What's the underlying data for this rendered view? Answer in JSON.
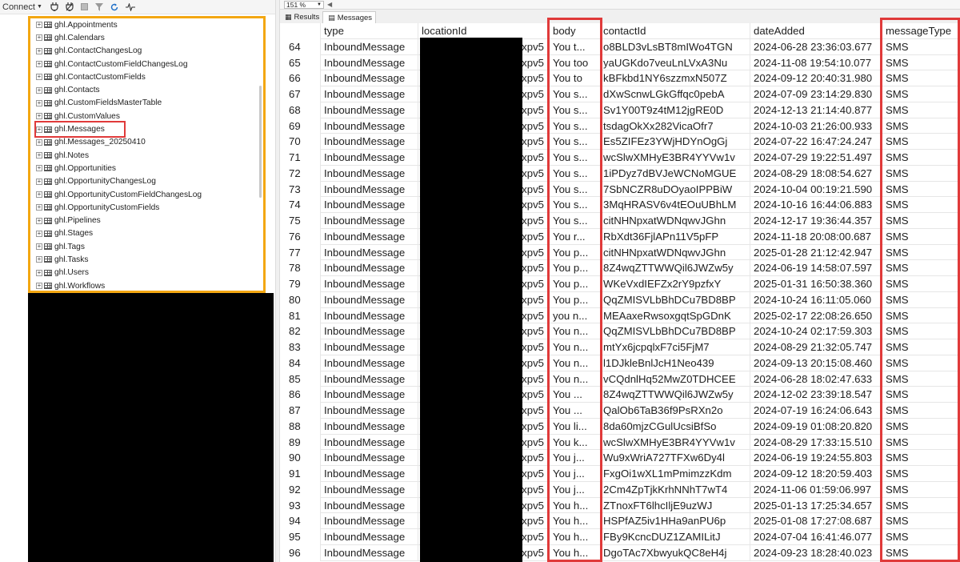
{
  "toolbar": {
    "connect_label": "Connect",
    "icons": [
      "connect-plug-icon",
      "disconnect-icon",
      "stop-icon",
      "filter-icon",
      "refresh-icon",
      "activity-monitor-icon"
    ]
  },
  "tree": {
    "items": [
      {
        "label": "ghl.Appointments"
      },
      {
        "label": "ghl.Calendars"
      },
      {
        "label": "ghl.ContactChangesLog"
      },
      {
        "label": "ghl.ContactCustomFieldChangesLog"
      },
      {
        "label": "ghl.ContactCustomFields"
      },
      {
        "label": "ghl.Contacts"
      },
      {
        "label": "ghl.CustomFieldsMasterTable"
      },
      {
        "label": "ghl.CustomValues"
      },
      {
        "label": "ghl.Messages",
        "selected": true
      },
      {
        "label": "ghl.Messages_20250410"
      },
      {
        "label": "ghl.Notes"
      },
      {
        "label": "ghl.Opportunities"
      },
      {
        "label": "ghl.OpportunityChangesLog"
      },
      {
        "label": "ghl.OpportunityCustomFieldChangesLog"
      },
      {
        "label": "ghl.OpportunityCustomFields"
      },
      {
        "label": "ghl.Pipelines"
      },
      {
        "label": "ghl.Stages"
      },
      {
        "label": "ghl.Tags"
      },
      {
        "label": "ghl.Tasks"
      },
      {
        "label": "ghl.Users"
      },
      {
        "label": "ghl.Workflows"
      }
    ]
  },
  "results": {
    "zoom": "151 %",
    "tabs": [
      {
        "label": "Results",
        "active": false
      },
      {
        "label": "Messages",
        "active": true
      }
    ],
    "columns": [
      "",
      "type",
      "locationId",
      "body",
      "contactId",
      "dateAdded",
      "messageType"
    ],
    "location_suffix": "xpv5",
    "rows": [
      {
        "n": "64",
        "type": "InboundMessage",
        "body": "You t...",
        "contactId": "o8BLD3vLsBT8mIWo4TGN",
        "dateAdded": "2024-06-28 23:36:03.677",
        "messageType": "SMS"
      },
      {
        "n": "65",
        "type": "InboundMessage",
        "body": "You too",
        "contactId": "yaUGKdo7veuLnLVxA3Nu",
        "dateAdded": "2024-11-08 19:54:10.077",
        "messageType": "SMS"
      },
      {
        "n": "66",
        "type": "InboundMessage",
        "body": "You to",
        "contactId": "kBFkbd1NY6szzmxN507Z",
        "dateAdded": "2024-09-12 20:40:31.980",
        "messageType": "SMS"
      },
      {
        "n": "67",
        "type": "InboundMessage",
        "body": "You s...",
        "contactId": "dXwScnwLGkGffqc0pebA",
        "dateAdded": "2024-07-09 23:14:29.830",
        "messageType": "SMS"
      },
      {
        "n": "68",
        "type": "InboundMessage",
        "body": "You s...",
        "contactId": "Sv1Y00T9z4tM12jgRE0D",
        "dateAdded": "2024-12-13 21:14:40.877",
        "messageType": "SMS"
      },
      {
        "n": "69",
        "type": "InboundMessage",
        "body": "You s...",
        "contactId": "tsdagOkXx282VicaOfr7",
        "dateAdded": "2024-10-03 21:26:00.933",
        "messageType": "SMS"
      },
      {
        "n": "70",
        "type": "InboundMessage",
        "body": "You s...",
        "contactId": "Es5ZIFEz3YWjHDYnOgGj",
        "dateAdded": "2024-07-22 16:47:24.247",
        "messageType": "SMS"
      },
      {
        "n": "71",
        "type": "InboundMessage",
        "body": "You s...",
        "contactId": "wcSlwXMHyE3BR4YYVw1v",
        "dateAdded": "2024-07-29 19:22:51.497",
        "messageType": "SMS"
      },
      {
        "n": "72",
        "type": "InboundMessage",
        "body": "You s...",
        "contactId": "1iPDyz7dBVJeWCNoMGUE",
        "dateAdded": "2024-08-29 18:08:54.627",
        "messageType": "SMS"
      },
      {
        "n": "73",
        "type": "InboundMessage",
        "body": "You s...",
        "contactId": "7SbNCZR8uDOyaoIPPBiW",
        "dateAdded": "2024-10-04 00:19:21.590",
        "messageType": "SMS"
      },
      {
        "n": "74",
        "type": "InboundMessage",
        "body": "You s...",
        "contactId": "3MqHRASV6v4tEOuUBhLM",
        "dateAdded": "2024-10-16 16:44:06.883",
        "messageType": "SMS"
      },
      {
        "n": "75",
        "type": "InboundMessage",
        "body": "You s...",
        "contactId": "citNHNpxatWDNqwvJGhn",
        "dateAdded": "2024-12-17 19:36:44.357",
        "messageType": "SMS"
      },
      {
        "n": "76",
        "type": "InboundMessage",
        "body": "You r...",
        "contactId": "RbXdt36FjlAPn11V5pFP",
        "dateAdded": "2024-11-18 20:08:00.687",
        "messageType": "SMS"
      },
      {
        "n": "77",
        "type": "InboundMessage",
        "body": "You p...",
        "contactId": "citNHNpxatWDNqwvJGhn",
        "dateAdded": "2025-01-28 21:12:42.947",
        "messageType": "SMS"
      },
      {
        "n": "78",
        "type": "InboundMessage",
        "body": "You p...",
        "contactId": "8Z4wqZTTWWQil6JWZw5y",
        "dateAdded": "2024-06-19 14:58:07.597",
        "messageType": "SMS"
      },
      {
        "n": "79",
        "type": "InboundMessage",
        "body": "You p...",
        "contactId": "WKeVxdIEFZx2rY9pzfxY",
        "dateAdded": "2025-01-31 16:50:38.360",
        "messageType": "SMS"
      },
      {
        "n": "80",
        "type": "InboundMessage",
        "body": "You p...",
        "contactId": "QqZMISVLbBhDCu7BD8BP",
        "dateAdded": "2024-10-24 16:11:05.060",
        "messageType": "SMS"
      },
      {
        "n": "81",
        "type": "InboundMessage",
        "body": "you n...",
        "contactId": "MEAaxeRwsoxgqtSpGDnK",
        "dateAdded": "2025-02-17 22:08:26.650",
        "messageType": "SMS"
      },
      {
        "n": "82",
        "type": "InboundMessage",
        "body": "You n...",
        "contactId": "QqZMISVLbBhDCu7BD8BP",
        "dateAdded": "2024-10-24 02:17:59.303",
        "messageType": "SMS"
      },
      {
        "n": "83",
        "type": "InboundMessage",
        "body": "You n...",
        "contactId": "mtYx6jcpqlxF7ci5FjM7",
        "dateAdded": "2024-08-29 21:32:05.747",
        "messageType": "SMS"
      },
      {
        "n": "84",
        "type": "InboundMessage",
        "body": "You n...",
        "contactId": "l1DJkleBnlJcH1Neo439",
        "dateAdded": "2024-09-13 20:15:08.460",
        "messageType": "SMS"
      },
      {
        "n": "85",
        "type": "InboundMessage",
        "body": "You n...",
        "contactId": "vCQdnlHq52MwZ0TDHCEE",
        "dateAdded": "2024-06-28 18:02:47.633",
        "messageType": "SMS"
      },
      {
        "n": "86",
        "type": "InboundMessage",
        "body": "You ...",
        "contactId": "8Z4wqZTTWWQil6JWZw5y",
        "dateAdded": "2024-12-02 23:39:18.547",
        "messageType": "SMS"
      },
      {
        "n": "87",
        "type": "InboundMessage",
        "body": "You ...",
        "contactId": "QalOb6TaB36f9PsRXn2o",
        "dateAdded": "2024-07-19 16:24:06.643",
        "messageType": "SMS"
      },
      {
        "n": "88",
        "type": "InboundMessage",
        "body": "You li...",
        "contactId": "8da60mjzCGulUcsiBfSo",
        "dateAdded": "2024-09-19 01:08:20.820",
        "messageType": "SMS"
      },
      {
        "n": "89",
        "type": "InboundMessage",
        "body": "You k...",
        "contactId": "wcSlwXMHyE3BR4YYVw1v",
        "dateAdded": "2024-08-29 17:33:15.510",
        "messageType": "SMS"
      },
      {
        "n": "90",
        "type": "InboundMessage",
        "body": "You j...",
        "contactId": "Wu9xWriA727TFXw6Dy4l",
        "dateAdded": "2024-06-19 19:24:55.803",
        "messageType": "SMS"
      },
      {
        "n": "91",
        "type": "InboundMessage",
        "body": "You j...",
        "contactId": "FxgOi1wXL1mPmimzzKdm",
        "dateAdded": "2024-09-12 18:20:59.403",
        "messageType": "SMS"
      },
      {
        "n": "92",
        "type": "InboundMessage",
        "body": "You j...",
        "contactId": "2Cm4ZpTjkKrhNNhT7wT4",
        "dateAdded": "2024-11-06 01:59:06.997",
        "messageType": "SMS"
      },
      {
        "n": "93",
        "type": "InboundMessage",
        "body": "You h...",
        "contactId": "ZTnoxFT6lhcIljE9uzWJ",
        "dateAdded": "2025-01-13 17:25:34.657",
        "messageType": "SMS"
      },
      {
        "n": "94",
        "type": "InboundMessage",
        "body": "You h...",
        "contactId": "HSPfAZ5iv1HHa9anPU6p",
        "dateAdded": "2025-01-08 17:27:08.687",
        "messageType": "SMS"
      },
      {
        "n": "95",
        "type": "InboundMessage",
        "body": "You h...",
        "contactId": "FBy9KcncDUZ1ZAMILitJ",
        "dateAdded": "2024-07-04 16:41:46.077",
        "messageType": "SMS"
      },
      {
        "n": "96",
        "type": "InboundMessage",
        "body": "You h...",
        "contactId": "DgoTAc7XbwyukQC8eH4j",
        "dateAdded": "2024-09-23 18:28:40.023",
        "messageType": "SMS"
      }
    ]
  },
  "colors": {
    "highlight_orange": "#f3a712",
    "highlight_red": "#e03a3a",
    "redaction": "#000000"
  }
}
